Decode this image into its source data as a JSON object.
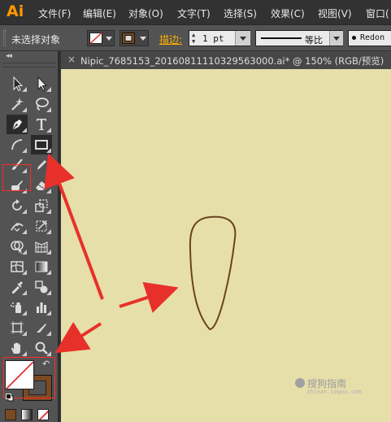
{
  "app": {
    "logo": "Ai"
  },
  "menu": [
    "文件(F)",
    "编辑(E)",
    "对象(O)",
    "文字(T)",
    "选择(S)",
    "效果(C)",
    "视图(V)",
    "窗口("
  ],
  "control_bar": {
    "selection_status": "未选择对象",
    "stroke_label": "描边:",
    "stroke_weight": "1 pt",
    "profile_label": "等比",
    "brush_label": "Redon"
  },
  "document_tab": {
    "close_glyph": "×",
    "label": "Nipic_7685153_20160811110329563000.ai* @ 150% (RGB/预览)"
  },
  "toolbar": {
    "collapse_glyph": "◂◂"
  },
  "fill_stroke": {
    "swap_glyph": "↶"
  },
  "watermark": {
    "text": "搜狗指南",
    "sub": "zhinan.sogou.com"
  },
  "colors": {
    "canvas": "#e6dfaa",
    "shape_stroke": "#6b4220",
    "annotation": "#e8302a",
    "stroke_color": "#7a4a23",
    "ui_panel": "#535353"
  }
}
